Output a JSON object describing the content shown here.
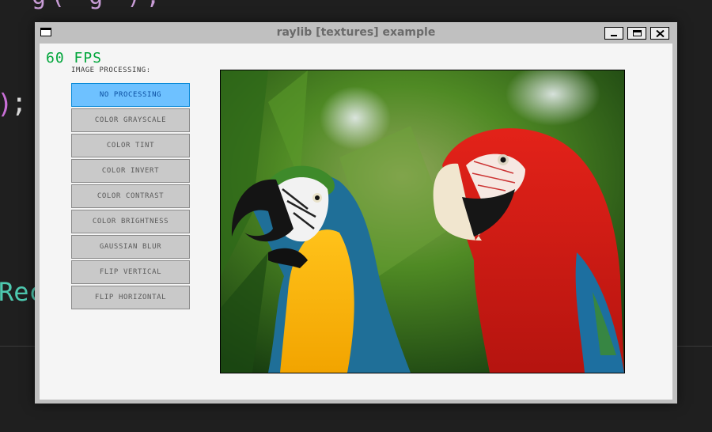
{
  "window": {
    "title": "raylib [textures] example"
  },
  "fps_counter": "60 FPS",
  "menu": {
    "label": "IMAGE PROCESSING:",
    "items": [
      {
        "label": "NO PROCESSING",
        "active": true
      },
      {
        "label": "COLOR GRAYSCALE",
        "active": false
      },
      {
        "label": "COLOR TINT",
        "active": false
      },
      {
        "label": "COLOR INVERT",
        "active": false
      },
      {
        "label": "COLOR CONTRAST",
        "active": false
      },
      {
        "label": "COLOR BRIGHTNESS",
        "active": false
      },
      {
        "label": "GAUSSIAN BLUR",
        "active": false
      },
      {
        "label": "FLIP VERTICAL",
        "active": false
      },
      {
        "label": "FLIP HORIZONTAL",
        "active": false
      }
    ]
  },
  "background_code": {
    "paren": ")",
    "semicolon": ";",
    "identifier": "Rec",
    "top_glyphs": "g(   g  ),"
  },
  "colors": {
    "fps_green": "#00a53a",
    "active_button": "#6ec1ff",
    "active_border": "#0a8ad8",
    "window_chrome": "#c0c0c0"
  },
  "icons": {
    "window": "window-icon",
    "minimize": "minimize-icon",
    "maximize": "maximize-icon",
    "close": "close-icon"
  }
}
